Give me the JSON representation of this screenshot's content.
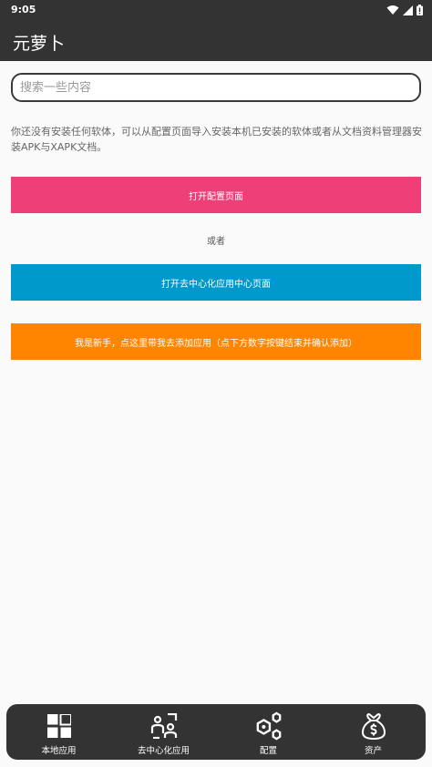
{
  "status": {
    "time": "9:05"
  },
  "appbar": {
    "title": "元萝卜"
  },
  "search": {
    "placeholder": "搜索一些内容",
    "value": ""
  },
  "notice": "你还没有安装任何软体，可以从配置页面导入安装本机已安装的软体或者从文档资料管理器安装APK与XAPK文档。",
  "buttons": {
    "config": "打开配置页面",
    "or": "或者",
    "decentral": "打开去中心化应用中心页面",
    "newbie": "我是新手，点这里带我去添加应用（点下方数字按键结束并确认添加）"
  },
  "nav": [
    {
      "label": "本地应用",
      "icon": "grid-icon"
    },
    {
      "label": "去中心化应用",
      "icon": "people-icon"
    },
    {
      "label": "配置",
      "icon": "hexagons-icon"
    },
    {
      "label": "资产",
      "icon": "money-bag-icon"
    }
  ],
  "colors": {
    "bar": "#333333",
    "pink": "#ee3f79",
    "blue": "#0099cc",
    "orange": "#ff8400"
  }
}
